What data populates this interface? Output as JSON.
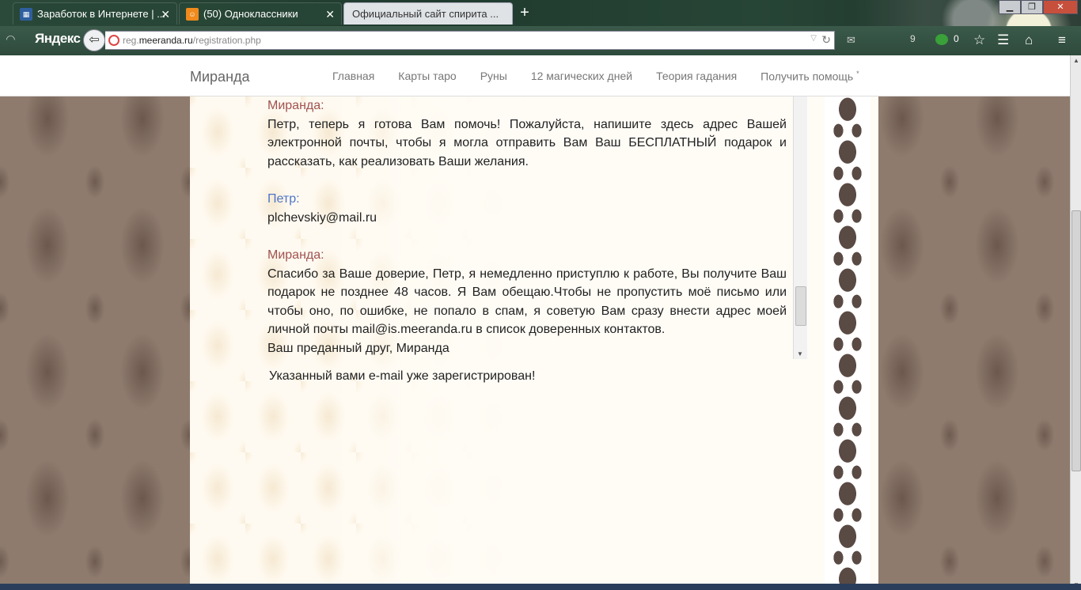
{
  "tabs": [
    {
      "label": "Заработок в Интернете | ...",
      "favicon": "site-favicon",
      "close": "✕"
    },
    {
      "label": "(50) Одноклассники",
      "favicon": "ok-favicon",
      "close": "✕"
    },
    {
      "label": "Официальный сайт спирита ...",
      "favicon": "none"
    }
  ],
  "new_tab": "+",
  "browser": {
    "brand": "Яндекс",
    "url_domain_prefix": "reg.",
    "url_domain": "meeranda.ru",
    "url_path": "/registration.php",
    "mail_count": "9",
    "green_count": "0"
  },
  "site": {
    "title": "Миранда",
    "menu": [
      "Главная",
      "Карты таро",
      "Руны",
      "12 магических дней",
      "Теория гадания",
      "Получить помощь"
    ],
    "menu_marker": "*"
  },
  "chat": [
    {
      "speaker": "Миранда:",
      "role": "miranda",
      "text": "Петр, теперь я готова Вам помочь! Пожалуйста, напишите здесь адрес Вашей электронной почты, чтобы я могла отправить Вам Ваш БЕСПЛАТНЫЙ подарок и рассказать, как реализовать Ваши желания."
    },
    {
      "speaker": "Петр:",
      "role": "petr",
      "text": "plchevskiy@mail.ru"
    },
    {
      "speaker": "Миранда:",
      "role": "miranda",
      "text": "Спасибо за Ваше доверие, Петр, я немедленно приступлю к работе, Вы получите Ваш подарок не позднее 48 часов. Я Вам обещаю.Чтобы не пропустить моё письмо или чтобы оно, по ошибке, не попало в спам, я советую Вам сразу внести адрес моей личной почты mail@is.meeranda.ru в список доверенных контактов.",
      "signature": "Ваш преданный друг, Миранда"
    }
  ],
  "notice": "Указанный вами e-mail уже зарегистрирован!"
}
